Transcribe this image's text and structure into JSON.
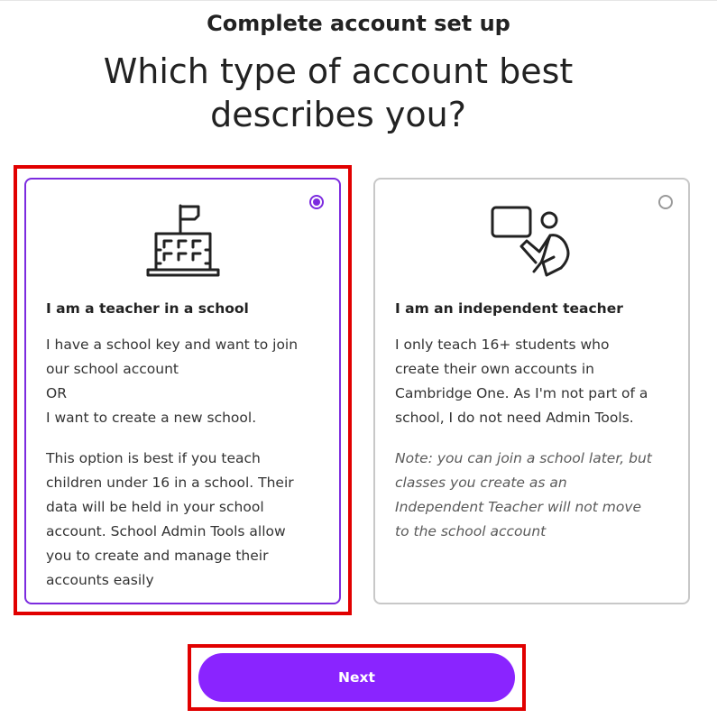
{
  "header": {
    "subtitle": "Complete account set up",
    "title": "Which type of account best describes you?"
  },
  "options": [
    {
      "heading": "I am a teacher in a school",
      "selected": true,
      "icon": "school-building-icon",
      "paragraph1": [
        "I have a school key and want to join",
        "our school account",
        "OR",
        "I want to create a new school."
      ],
      "paragraph2": [
        "This option is best if you teach",
        "children under 16 in a school. Their",
        "data will be held in your school",
        "account. School Admin Tools allow",
        "you to create and manage their",
        "accounts easily"
      ]
    },
    {
      "heading": "I am an independent teacher",
      "selected": false,
      "icon": "teacher-presenting-icon",
      "paragraph1": [
        "I only teach 16+ students who",
        "create their own accounts in",
        "Cambridge One. As I'm not part of a",
        "school, I do not need Admin Tools."
      ],
      "paragraph2": [
        "Note: you can join a school later, but",
        "classes you create as an",
        "Independent Teacher will not move",
        "to the school account"
      ]
    }
  ],
  "next_button": {
    "label": "Next"
  },
  "colors": {
    "accent": "#8a24ff",
    "selected_border": "#7c2bdf",
    "unselected_border": "#c8c8c8",
    "highlight": "#e10000"
  }
}
